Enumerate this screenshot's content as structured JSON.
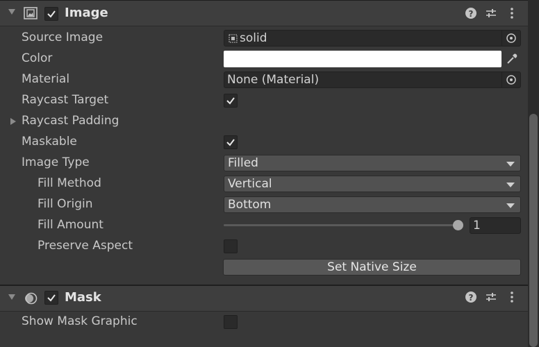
{
  "image_component": {
    "title": "Image",
    "enabled": true,
    "source_image_label": "Source Image",
    "source_image_value": "solid",
    "color_label": "Color",
    "color_value": "#ffffff",
    "material_label": "Material",
    "material_value": "None (Material)",
    "raycast_target_label": "Raycast Target",
    "raycast_target_checked": true,
    "raycast_padding_label": "Raycast Padding",
    "maskable_label": "Maskable",
    "maskable_checked": true,
    "image_type_label": "Image Type",
    "image_type_value": "Filled",
    "fill_method_label": "Fill Method",
    "fill_method_value": "Vertical",
    "fill_origin_label": "Fill Origin",
    "fill_origin_value": "Bottom",
    "fill_amount_label": "Fill Amount",
    "fill_amount_value": "1",
    "preserve_aspect_label": "Preserve Aspect",
    "preserve_aspect_checked": false,
    "set_native_size_label": "Set Native Size"
  },
  "mask_component": {
    "title": "Mask",
    "enabled": true,
    "show_mask_graphic_label": "Show Mask Graphic",
    "show_mask_graphic_checked": false
  },
  "icons": {
    "fold": "foldout-arrow-icon",
    "image": "image-component-icon",
    "mask": "mask-component-icon",
    "help": "help-icon",
    "presets": "presets-sliders-icon",
    "menu": "kebab-menu-icon",
    "object_picker": "object-picker-icon",
    "eyedropper": "eyedropper-icon",
    "sprite": "sprite-icon"
  },
  "colors": {
    "background": "#383838",
    "header": "#3e3e3e",
    "field": "#2a2a2a",
    "dropdown": "#515151",
    "button": "#575757"
  }
}
